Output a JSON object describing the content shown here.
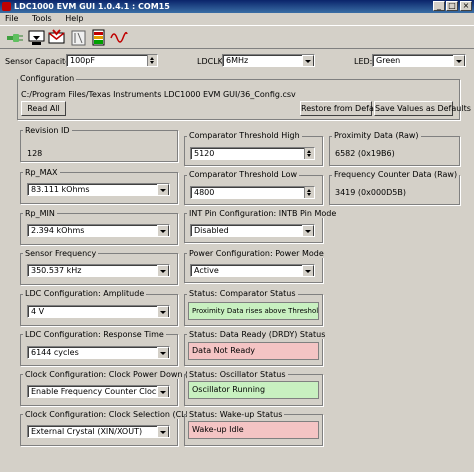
{
  "window": {
    "title": "LDC1000 EVM GUI 1.0.4.1 : COM15"
  },
  "menu": [
    "File",
    "Tools",
    "Help"
  ],
  "toolbar": {
    "icons": [
      "connect-icon",
      "download-icon",
      "mail-icon",
      "chart-icon",
      "battery-icon",
      "waveform-icon"
    ]
  },
  "top": {
    "sensor_cap_label": "Sensor Capacitor:",
    "sensor_cap_value": "100pF",
    "ldclk_label": "LDCLK:",
    "ldclk_value": "6MHz",
    "led_label": "LED:",
    "led_value": "Green"
  },
  "config": {
    "group_label": "Configuration",
    "path": "C:/Program Files/Texas Instruments LDC1000 EVM GUI/36_Config.csv",
    "read_all": "Read All",
    "restore": "Restore from Defaults",
    "save_defaults": "Save Values as Defaults"
  },
  "left": {
    "revision": {
      "label": "Revision ID",
      "value": "128"
    },
    "rp_max": {
      "label": "Rp_MAX",
      "value": "83.111 kOhms"
    },
    "rp_min": {
      "label": "Rp_MIN",
      "value": "2.394 kOhms"
    },
    "sensor_freq": {
      "label": "Sensor Frequency",
      "value": "350.537 kHz"
    },
    "amplitude": {
      "label": "LDC Configuration: Amplitude",
      "value": "4 V"
    },
    "response": {
      "label": "LDC Configuration: Response Time",
      "value": "6144 cycles"
    },
    "clk_pd": {
      "label": "Clock Configuration: Clock Power Down (CLK_PD)",
      "value": "Enable Frequency Counter Clock"
    },
    "clk_sel": {
      "label": "Clock Configuration: Clock Selection (CLK_SEL)",
      "value": "External Crystal (XIN/XOUT)"
    }
  },
  "middle": {
    "thresh_high": {
      "label": "Comparator Threshold High",
      "value": "5120"
    },
    "thresh_low": {
      "label": "Comparator Threshold Low",
      "value": "4800"
    },
    "intb": {
      "label": "INT Pin Configuration: INTB Pin Mode",
      "value": "Disabled"
    },
    "power": {
      "label": "Power Configuration: Power Mode",
      "value": "Active"
    },
    "comp_status": {
      "label": "Status: Comparator Status",
      "value": "Proximity Data rises above Threshold High",
      "color": "#c8f0c0"
    },
    "drdy_status": {
      "label": "Status: Data Ready (DRDY) Status",
      "value": "Data Not Ready",
      "color": "#f4c4c4"
    },
    "osc_status": {
      "label": "Status: Oscillator Status",
      "value": "Oscillator Running",
      "color": "#c8f0c0"
    },
    "wake_status": {
      "label": "Status: Wake-up Status",
      "value": "Wake-up Idle",
      "color": "#f4c4c4"
    }
  },
  "right": {
    "prox": {
      "label": "Proximity Data (Raw)",
      "value": "6582 (0x19B6)"
    },
    "freq": {
      "label": "Frequency Counter Data (Raw)",
      "value": "3419 (0x000D5B)"
    }
  }
}
